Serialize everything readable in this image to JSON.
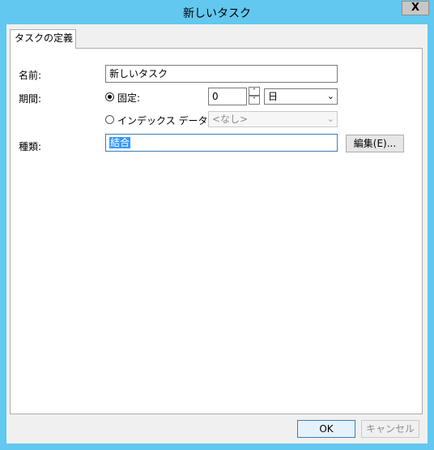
{
  "window": {
    "title": "新しいタスク",
    "close_glyph": "X"
  },
  "tab": {
    "label": "タスクの定義"
  },
  "form": {
    "name_label": "名前:",
    "name_value": "新しいタスク",
    "duration_label": "期間:",
    "fixed_label": "固定:",
    "fixed_value": "0",
    "unit_value": "日",
    "index_label": "インデックス データ:",
    "index_value": "<なし>",
    "type_label": "種類:",
    "type_value": "結合",
    "edit_button": "編集(E)..."
  },
  "buttons": {
    "ok": "OK",
    "cancel": "キャンセル"
  },
  "icons": {
    "spin_up": "˄",
    "spin_down": "˅",
    "dropdown": "⌄"
  }
}
